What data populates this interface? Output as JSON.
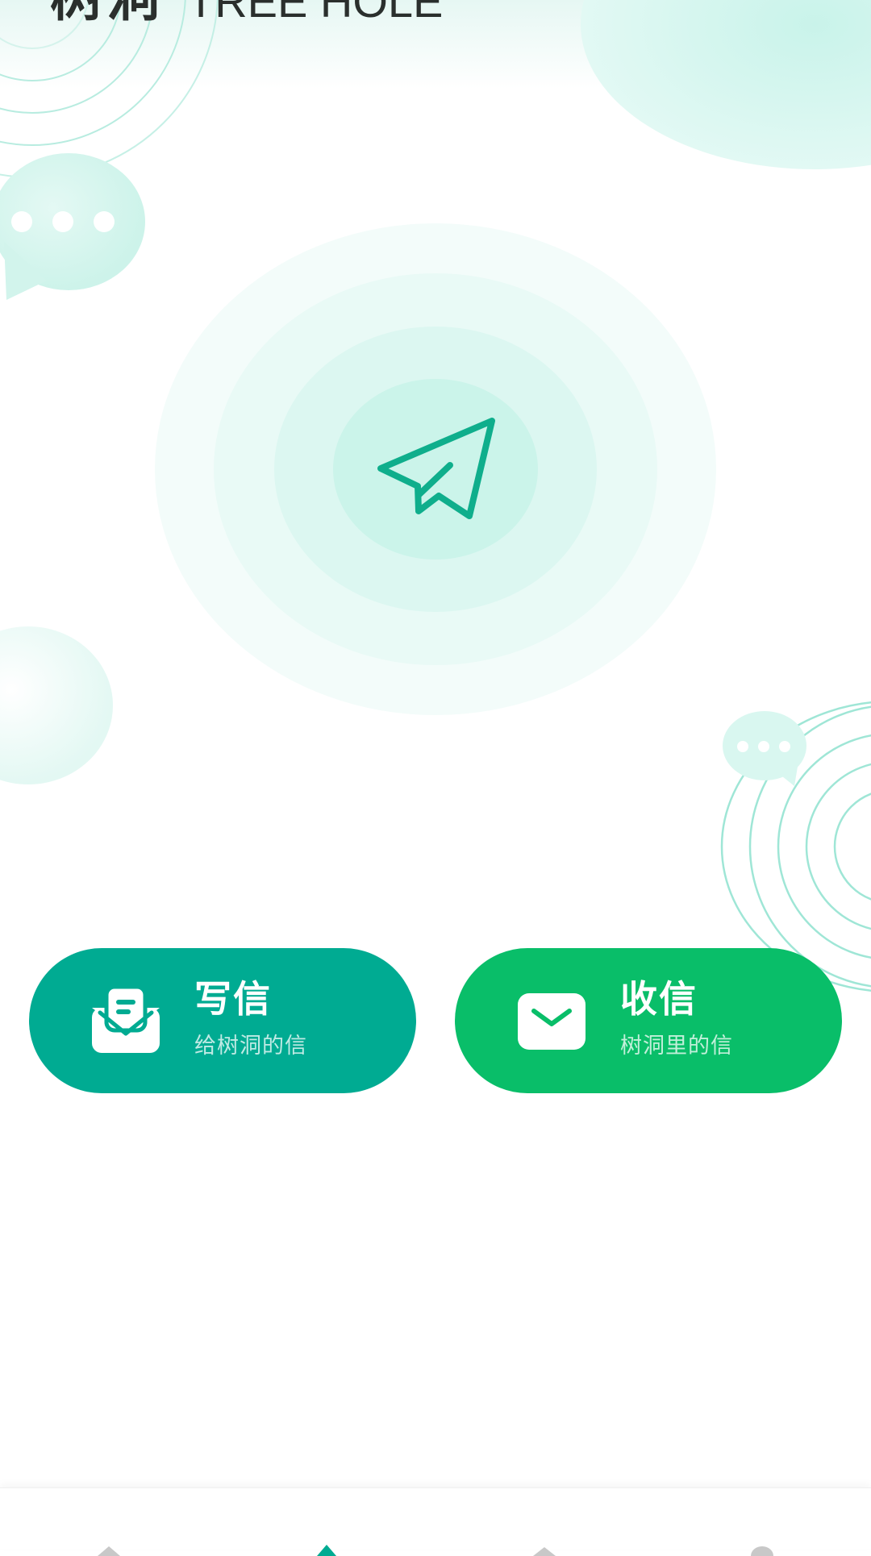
{
  "header": {
    "title_cn": "树洞",
    "title_en": "TREE HOLE"
  },
  "actions": {
    "write": {
      "title": "写信",
      "subtitle": "给树洞的信",
      "icon": "letter-open-icon",
      "color": "#00ab92"
    },
    "receive": {
      "title": "收信",
      "subtitle": "树洞里的信",
      "icon": "envelope-icon",
      "color": "#09be69"
    }
  },
  "center": {
    "icon": "paper-plane-icon",
    "accent": "#0fae8c"
  },
  "tabbar": {
    "tabs": [
      {
        "icon": "home-icon",
        "active": false
      },
      {
        "icon": "tree-hole-icon",
        "active": true
      },
      {
        "icon": "message-icon",
        "active": false
      },
      {
        "icon": "profile-icon",
        "active": false
      }
    ]
  }
}
